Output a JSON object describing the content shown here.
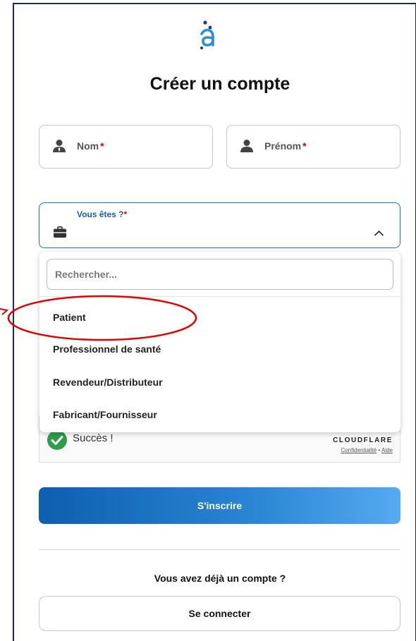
{
  "header": {
    "logo": "logo-a-icon",
    "title": "Créer un compte"
  },
  "form": {
    "nom": {
      "label": "Nom",
      "required": "*"
    },
    "prenom": {
      "label": "Prénom",
      "required": "*"
    },
    "type": {
      "label": "Vous êtes ?",
      "required": "*"
    }
  },
  "dropdown": {
    "search_placeholder": "Rechercher...",
    "options": [
      "Patient",
      "Professionnel de santé",
      "Revendeur/Distributeur",
      "Fabricant/Fournisseur"
    ]
  },
  "captcha": {
    "status": "Succès !",
    "brand": "CLOUDFLARE",
    "privacy": "Confidentialité",
    "separator": "•",
    "help": "Aide"
  },
  "buttons": {
    "signup": "S'inscrire",
    "login": "Se connecter"
  },
  "footer": {
    "already": "Vous avez déjà un compte ?"
  },
  "colors": {
    "accent": "#1e6fb8",
    "required": "#d40000",
    "annotation": "#e00000",
    "success": "#2e9e4a"
  }
}
